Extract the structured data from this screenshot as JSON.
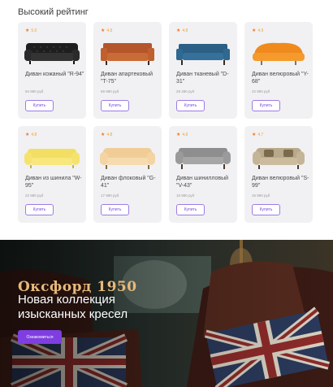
{
  "section": {
    "title": "Высокий рейтинг"
  },
  "products": [
    {
      "rating": "5.0",
      "name": "Диван кожаный \"R-94\"",
      "price": "94 990 руб",
      "buy": "Купить",
      "icon": "sofa-black-leather"
    },
    {
      "rating": "4.9",
      "name": "Диван апартековый \"T-75\"",
      "price": "69 990 руб",
      "buy": "Купить",
      "icon": "sofa-orange-leather"
    },
    {
      "rating": "4.8",
      "name": "Диван тканевый \"D-31\"",
      "price": "28 490 руб",
      "buy": "Купить",
      "icon": "sofa-blue-fabric"
    },
    {
      "rating": "4.9",
      "name": "Диван велюровый \"Y-68\"",
      "price": "22 990 руб",
      "buy": "Купить",
      "icon": "sofa-orange-velour"
    },
    {
      "rating": "4.8",
      "name": "Диван из шинила \"W-95\"",
      "price": "22 990 руб",
      "buy": "Купить",
      "icon": "sofa-yellow"
    },
    {
      "rating": "4.8",
      "name": "Диван флоковый \"G-41\"",
      "price": "17 990 руб",
      "buy": "Купить",
      "icon": "sofa-beige"
    },
    {
      "rating": "4.8",
      "name": "Диван шинилловый \"V-43\"",
      "price": "15 990 руб",
      "buy": "Купить",
      "icon": "sofa-gray"
    },
    {
      "rating": "4.7",
      "name": "Диван велюровый \"S-99\"",
      "price": "15 990 руб",
      "buy": "Купить",
      "icon": "sofa-taupe"
    }
  ],
  "banner": {
    "brand": "Оксфорд 1950",
    "subtitle": "Новая коллекция изысканных кресел",
    "button": "Ознакомиться"
  },
  "colors": {
    "accent": "#7e3ee0",
    "star": "#f07a2a",
    "brand_gold": "#e7b97b"
  }
}
